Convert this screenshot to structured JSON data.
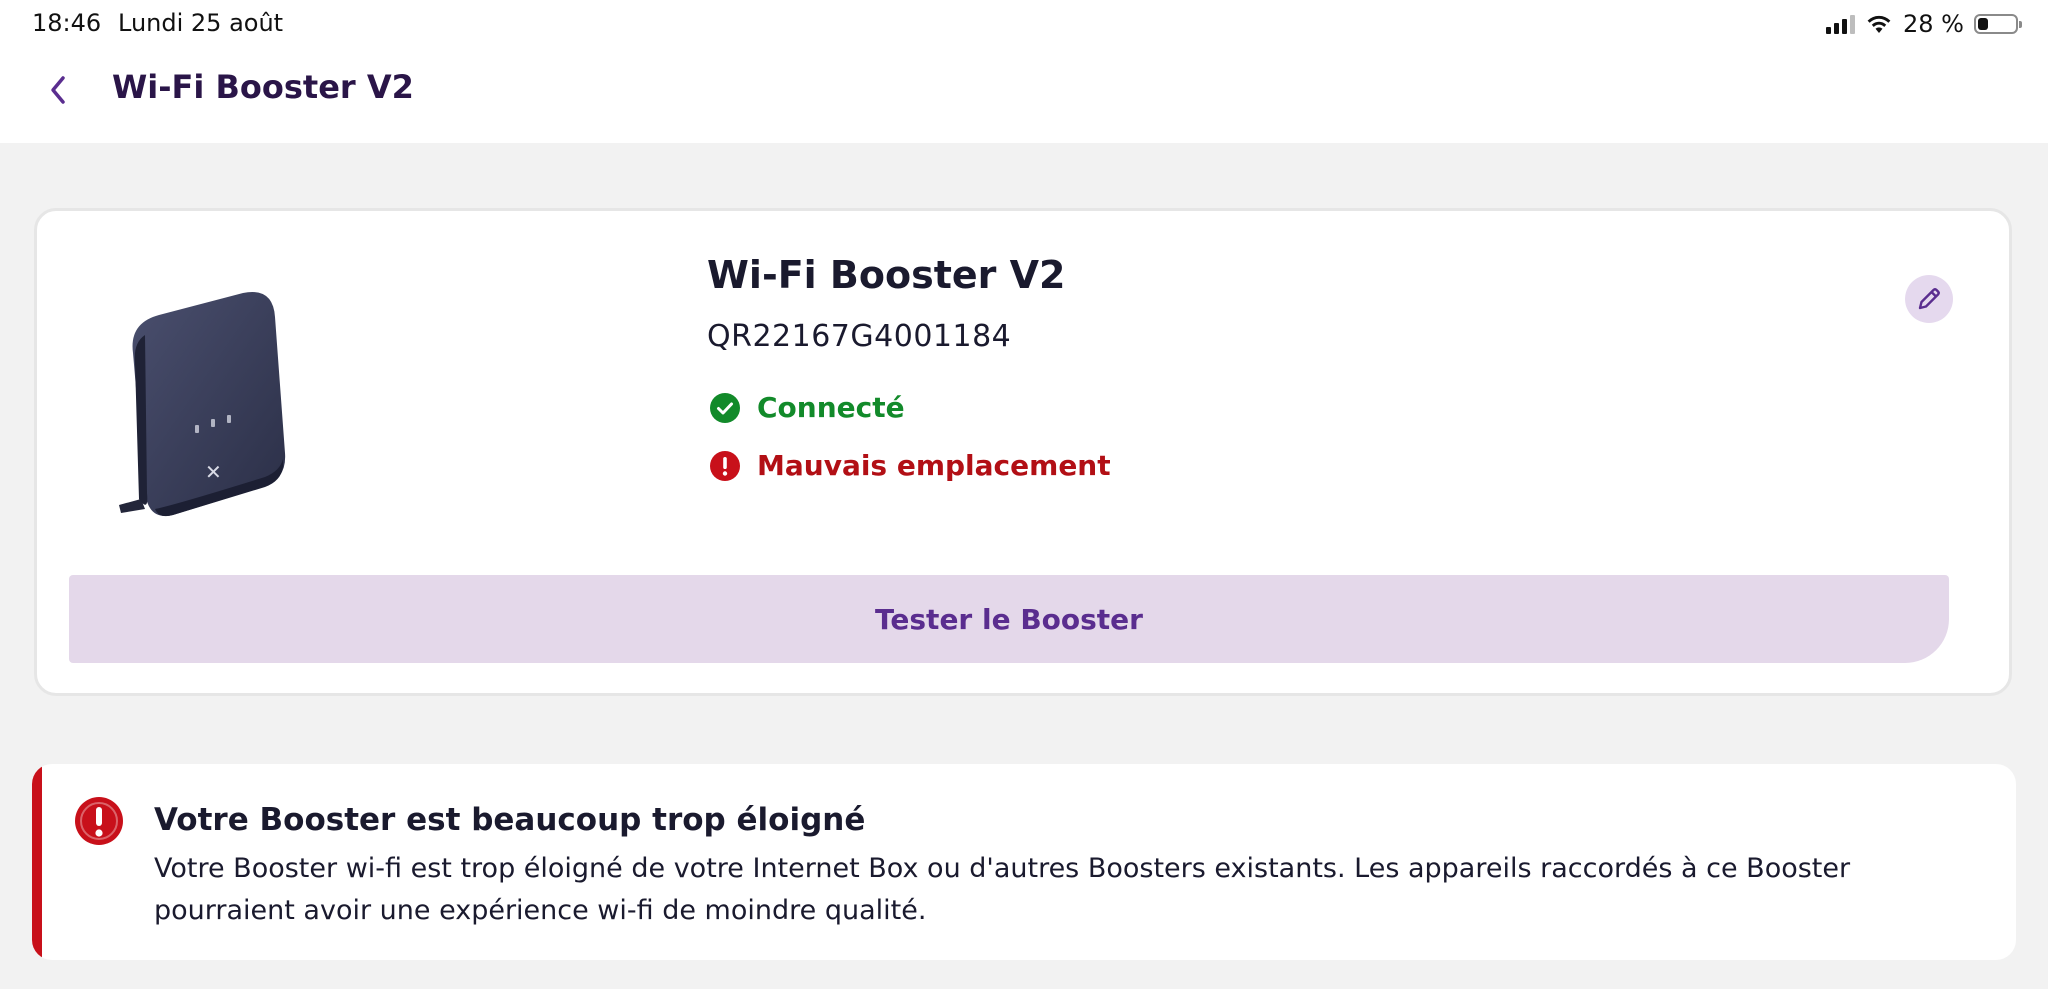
{
  "status_bar": {
    "time": "18:46",
    "date": "Lundi 25 août",
    "battery_text": "28 %",
    "battery_level": 0.28
  },
  "header": {
    "title": "Wi-Fi Booster V2",
    "back_icon": "chevron-left-icon"
  },
  "device": {
    "name": "Wi-Fi Booster V2",
    "serial": "QR22167G4001184",
    "status_connected": "Connecté",
    "status_placement": "Mauvais emplacement",
    "test_button_label": "Tester le Booster",
    "edit_icon": "pencil-icon"
  },
  "alert": {
    "title": "Votre Booster est beaucoup trop éloigné",
    "body": "Votre Booster wi-fi est trop éloigné de votre Internet Box ou d'autres Boosters existants. Les appareils raccordés à ce Booster pourraient avoir une expérience wi-fi de moindre qualité."
  },
  "colors": {
    "accent": "#5a2d8f",
    "success": "#128a2a",
    "error": "#b20f15",
    "button_bg": "#e4d8ea"
  }
}
